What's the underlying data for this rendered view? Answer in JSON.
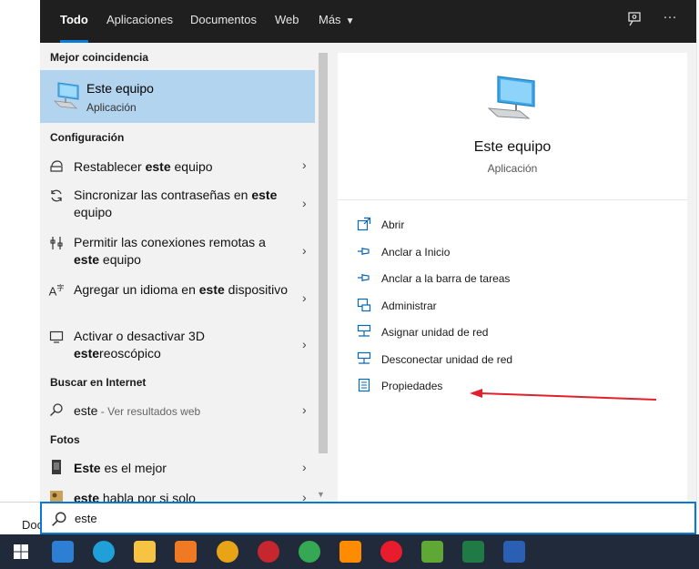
{
  "background": {
    "doc_label": "Doc"
  },
  "tabs": [
    {
      "label": "Todo",
      "active": true
    },
    {
      "label": "Aplicaciones"
    },
    {
      "label": "Documentos"
    },
    {
      "label": "Web"
    },
    {
      "label": "Más",
      "has_caret": true
    }
  ],
  "top_icons": [
    "feedback-icon",
    "more-options-icon"
  ],
  "more_glyph": "···",
  "chevron_glyph": "›",
  "sections": {
    "best_match": "Mejor coincidencia",
    "settings": "Configuración",
    "web": "Buscar en Internet",
    "photos": "Fotos"
  },
  "best_match": {
    "title": "Este equipo",
    "subtitle": "Aplicación"
  },
  "settings_results": [
    {
      "pre": "Restablecer ",
      "bold": "este",
      "post": " equipo"
    },
    {
      "pre": "Sincronizar las contraseñas en ",
      "bold": "este",
      "post": " equipo"
    },
    {
      "pre": "Permitir las conexiones remotas a ",
      "bold": "este",
      "post": " equipo"
    },
    {
      "pre": "Agregar un idioma en ",
      "bold": "este",
      "post": " dispositivo"
    },
    {
      "pre": "Activar o desactivar 3D ",
      "bold": "este",
      "post": "reoscópico"
    }
  ],
  "web_result": {
    "query": "este",
    "hint": " - Ver resultados web"
  },
  "photo_results": [
    {
      "bold": "Este",
      "post": " es el mejor"
    },
    {
      "bold": "este",
      "post": " habla por si solo"
    }
  ],
  "preview": {
    "title": "Este equipo",
    "subtitle": "Aplicación"
  },
  "actions": [
    {
      "label": "Abrir",
      "icon": "open-icon"
    },
    {
      "label": "Anclar a Inicio",
      "icon": "pin-icon"
    },
    {
      "label": "Anclar a la barra de tareas",
      "icon": "pin-icon"
    },
    {
      "label": "Administrar",
      "icon": "manage-icon"
    },
    {
      "label": "Asignar unidad de red",
      "icon": "map-network-drive-icon"
    },
    {
      "label": "Desconectar unidad de red",
      "icon": "disconnect-network-drive-icon"
    },
    {
      "label": "Propiedades",
      "icon": "properties-icon"
    }
  ],
  "search": {
    "value": "este"
  },
  "taskbar": {
    "items": [
      {
        "name": "start-button",
        "color": "#ffffff"
      },
      {
        "name": "store-app",
        "color": "#2d7fd3"
      },
      {
        "name": "edge-app",
        "color": "#1fa0d8"
      },
      {
        "name": "explorer-app",
        "color": "#f6c342"
      },
      {
        "name": "xampp-app",
        "color": "#f07a23"
      },
      {
        "name": "app-5",
        "color": "#e8a317"
      },
      {
        "name": "app-6",
        "color": "#c6262e"
      },
      {
        "name": "chrome-app",
        "color": "#34a853"
      },
      {
        "name": "app-8",
        "color": "#ff8c00"
      },
      {
        "name": "opera-app",
        "color": "#e81c2c"
      },
      {
        "name": "app-10",
        "color": "#5fa836"
      },
      {
        "name": "excel-app",
        "color": "#1f7a45"
      },
      {
        "name": "word-app",
        "color": "#2b5fb3"
      }
    ]
  },
  "colors": {
    "accent": "#0a7bd6",
    "selection": "#b3d4ee",
    "topbar": "#1f1f1f",
    "taskbar": "#202a3a",
    "annotation_arrow": "#e0202a"
  }
}
